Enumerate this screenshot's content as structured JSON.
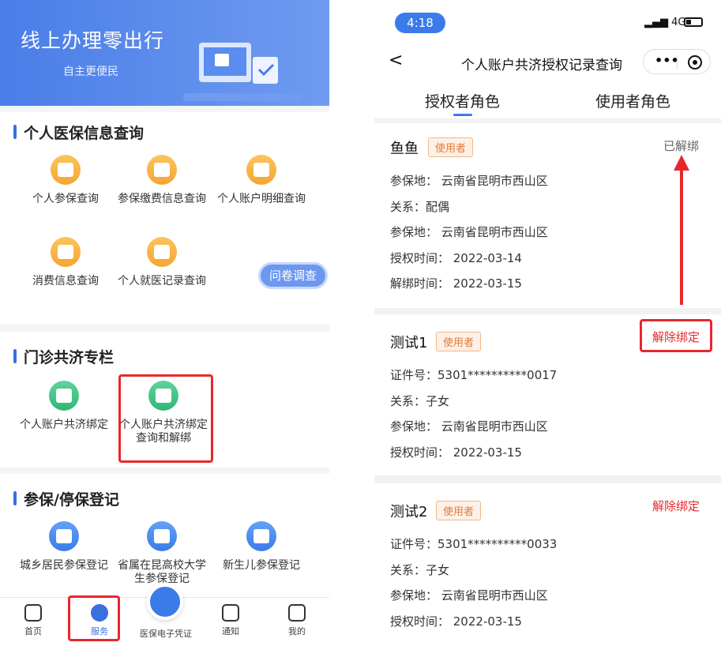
{
  "left": {
    "banner": {
      "title": "线上办理零出行",
      "subtitle": "自主更便民"
    },
    "section1": {
      "title": "个人医保信息查询",
      "items": [
        {
          "label": "个人参保查询"
        },
        {
          "label": "参保缴费信息查询"
        },
        {
          "label": "个人账户明细查询"
        },
        {
          "label": "消费信息查询"
        },
        {
          "label": "个人就医记录查询"
        }
      ]
    },
    "survey_label": "问卷调查",
    "section2": {
      "title": "门诊共济专栏",
      "items": [
        {
          "label": "个人账户共济绑定"
        },
        {
          "label": "个人账户共济绑定查询和解绑"
        }
      ]
    },
    "section3": {
      "title": "参保/停保登记",
      "items": [
        {
          "label": "城乡居民参保登记"
        },
        {
          "label": "省属在昆高校大学生参保登记"
        },
        {
          "label": "新生儿参保登记"
        }
      ]
    },
    "tabbar": {
      "home": "首页",
      "service": "服务",
      "voucher": "医保电子凭证",
      "notice": "通知",
      "mine": "我的"
    }
  },
  "right": {
    "status": {
      "time": "4:18",
      "network": "4G"
    },
    "nav": {
      "back": "<",
      "title": "个人账户共济授权记录查询",
      "more": "•••"
    },
    "tabs": {
      "grantor": "授权者角色",
      "user": "使用者角色"
    },
    "records": [
      {
        "name": "鱼鱼",
        "tag": "使用者",
        "action": "已解绑",
        "lines": [
          "参保地： 云南省昆明市西山区",
          "关系：配偶",
          "参保地： 云南省昆明市西山区",
          "授权时间： 2022-03-14",
          "解绑时间： 2022-03-15"
        ]
      },
      {
        "name": "测试1",
        "tag": "使用者",
        "action": "解除绑定",
        "lines": [
          "证件号：5301**********0017",
          "关系：子女",
          "参保地： 云南省昆明市西山区",
          "授权时间： 2022-03-15"
        ]
      },
      {
        "name": "测试2",
        "tag": "使用者",
        "action": "解除绑定",
        "lines": [
          "证件号：5301**********0033",
          "关系：子女",
          "参保地： 云南省昆明市西山区",
          "授权时间： 2022-03-15"
        ]
      }
    ]
  },
  "colors": {
    "accent": "#3a7be9",
    "highlight": "#e8272b",
    "tag": "#e07b39"
  }
}
